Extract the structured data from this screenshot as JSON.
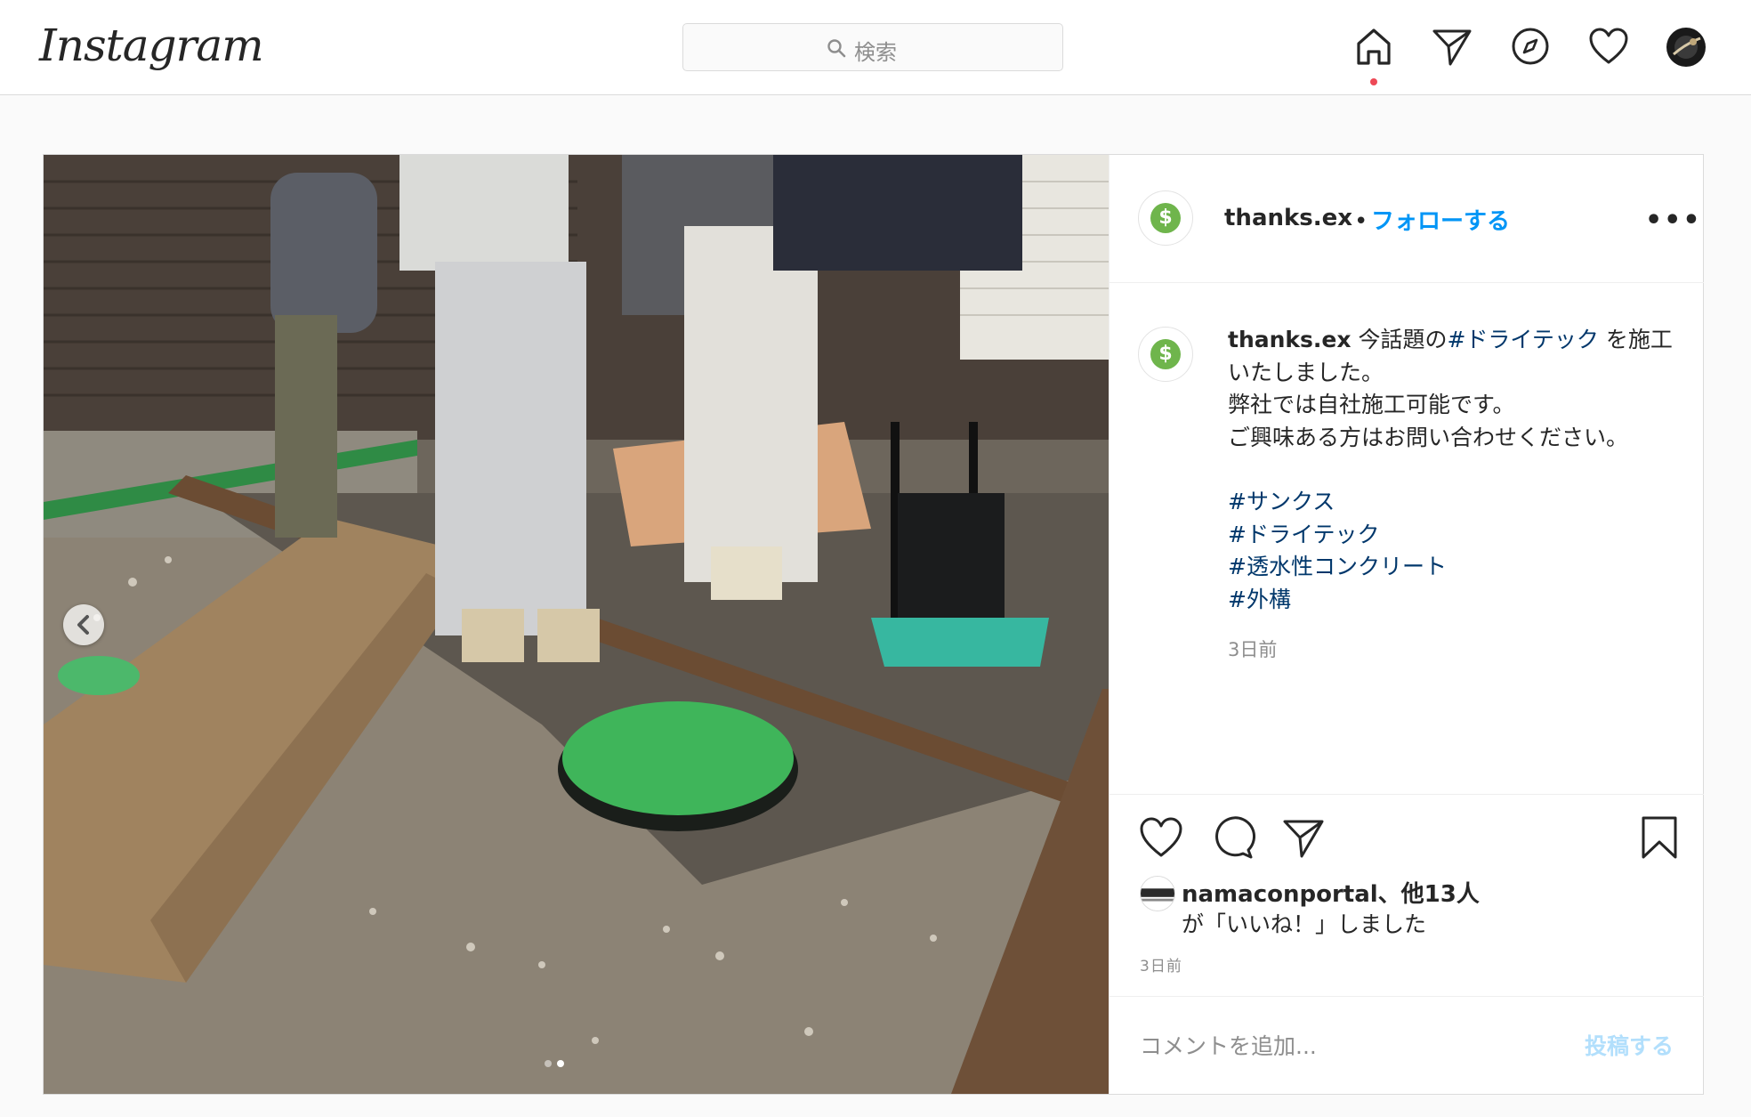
{
  "nav": {
    "logo": "Instagram",
    "search_placeholder": "検索",
    "icons": [
      "home-icon",
      "direct-icon",
      "explore-icon",
      "activity-heart-icon",
      "profile-avatar"
    ]
  },
  "post": {
    "username": "thanks.ex",
    "separator": "•",
    "follow_label": "フォローする",
    "more_label": "•••",
    "caption": {
      "username": "thanks.ex",
      "line1_prefix": "今話題の",
      "line1_tag": "#ドライテック",
      "line1_suffix": " を施工",
      "line2": "いたしました。",
      "line3": "弊社では自社施工可能です。",
      "line4": "ご興味ある方はお問い合わせください。",
      "hashtags": [
        "#サンクス",
        "#ドライテック",
        "#透水性コンクリート",
        "#外構"
      ]
    },
    "caption_time": "3日前",
    "likes": {
      "line1": "namaconportal、他13人",
      "line2": "が「いいね！」しました"
    },
    "post_time": "3日前",
    "comment_placeholder": "コメントを追加...",
    "post_button": "投稿する",
    "carousel": {
      "slide_count": 2,
      "active_index": 1
    }
  },
  "colors": {
    "link_blue": "#0095f6",
    "hashtag_blue": "#00376b",
    "border": "#dbdbdb",
    "background": "#fafafa",
    "notification_dot": "#ed4956",
    "logo_green": "#6fb54c"
  }
}
